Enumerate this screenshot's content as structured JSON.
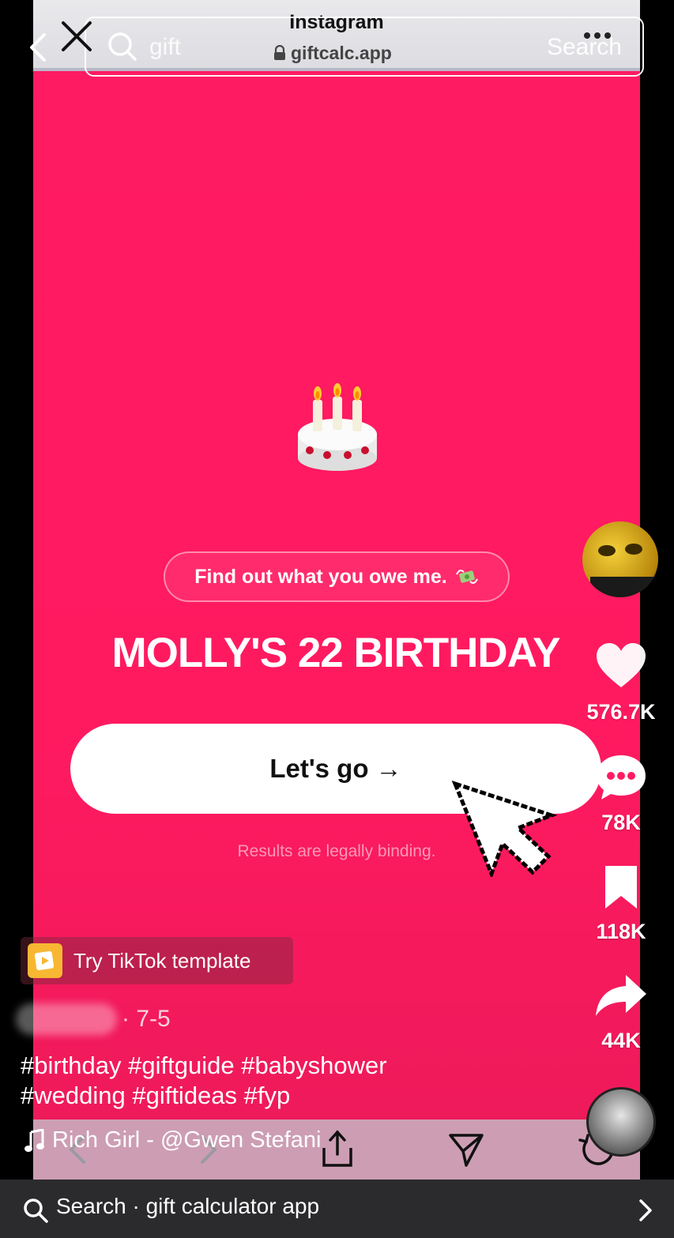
{
  "browser": {
    "title": "Instagram",
    "url": "giftcalc.app",
    "search_text": "gift",
    "search_button": "Search"
  },
  "page": {
    "tag_text": "Find out what you owe me.",
    "headline": "MOLLY'S 22 BIRTHDAY",
    "cta_label": "Let's go →",
    "legal_text": "Results are legally binding."
  },
  "sidebar": {
    "likes": "576.7K",
    "comments": "78K",
    "saves": "118K",
    "shares": "44K"
  },
  "post": {
    "template_label": "Try TikTok template",
    "date": "· 7-5",
    "caption_line1": "#birthday #giftguide #babyshower",
    "caption_line2": "#wedding #giftideas #fyp",
    "music": "Rich Girl - @Gwen Stefani"
  },
  "bottom_search": {
    "text": "Search · gift calculator app"
  },
  "colors": {
    "accent": "#ff1b63",
    "template_icon": "#f7b733"
  }
}
